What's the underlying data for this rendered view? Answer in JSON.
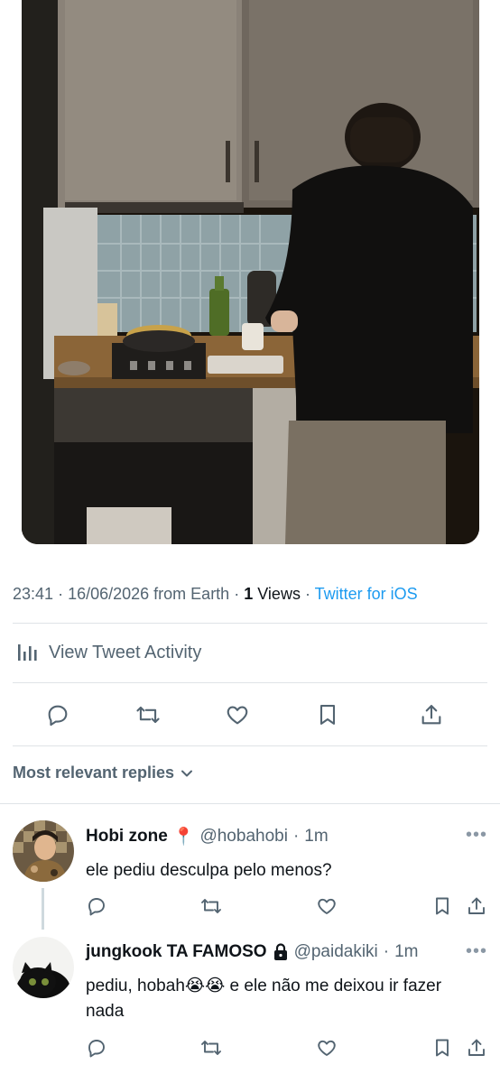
{
  "tweet": {
    "time": "23:41",
    "date": "16/06/2026",
    "location": "from Earth",
    "views_count": "1",
    "views_label": "Views",
    "source": "Twitter for iOS",
    "activity_label": "View Tweet Activity",
    "image_icon": "photo-kitchen"
  },
  "replies_header": {
    "label": "Most relevant replies",
    "icon": "chevron-down-icon"
  },
  "replies": [
    {
      "name": "Hobi zone",
      "emoji": "📍",
      "handle": "@hobahobi",
      "time": "1m",
      "text": "ele pediu desculpa pelo menos?"
    },
    {
      "name": "jungkook TA FAMOSO",
      "handle": "@paidakiki",
      "time": "1m",
      "text": "pediu, hobah😭😭 e ele não me deixou ir fazer nada"
    }
  ],
  "colors": {
    "accent": "#1d9bf0",
    "secondary_text": "#536471",
    "divider": "#dfe3e7"
  },
  "icons": [
    "reply-icon",
    "retweet-icon",
    "like-icon",
    "bookmark-icon",
    "share-icon",
    "activity-chart-icon",
    "more-icon",
    "lock-icon"
  ]
}
